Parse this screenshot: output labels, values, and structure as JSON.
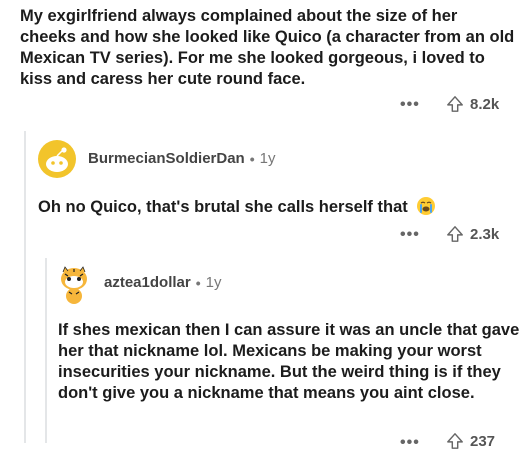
{
  "post": {
    "body": "My exgirlfriend always complained about the size of her cheeks and how she looked like Quico (a character from an old Mexican TV series). For me she looked gorgeous, i loved to kiss and caress her cute round face.",
    "more_label": "•••",
    "upvotes": "8.2k"
  },
  "comment1": {
    "username": "BurmecianSoldierDan",
    "separator": "•",
    "age": "1y",
    "body": "Oh no Quico, that's brutal she calls herself that",
    "emoji_icon": "loudly-crying-face-icon",
    "more_label": "•••",
    "upvotes": "2.3k"
  },
  "comment2": {
    "username": "aztea1dollar",
    "separator": "•",
    "age": "1y",
    "body": "If shes mexican then I can assure it was an uncle that gave her that nickname lol. Mexicans be making your worst insecurities your nickname. But the weird thing is if they don't give you a nickname that means you aint close.",
    "more_label": "•••",
    "upvotes": "237"
  },
  "colors": {
    "thread_line": "#e4e6e8",
    "avatar_yellow": "#f2c42b",
    "text": "#1c1c1c"
  }
}
